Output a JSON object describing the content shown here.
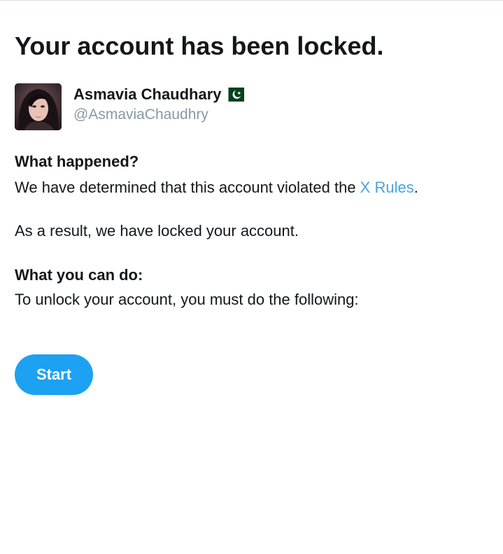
{
  "page": {
    "title": "Your account has been locked."
  },
  "profile": {
    "name": "Asmavia Chaudhary",
    "flag_icon": "pakistan-flag-icon",
    "handle": "@AsmaviaChaudhry",
    "avatar": "profile-photo"
  },
  "what_happened": {
    "heading": "What happened?",
    "text_before_link": "We have determined that this account violated the ",
    "link_label": "X Rules",
    "text_after_link": ".",
    "result_text": "As a result, we have locked your account."
  },
  "what_you_can_do": {
    "heading": "What you can do:",
    "text": "To unlock your account, you must do the following:"
  },
  "actions": {
    "start_label": "Start"
  },
  "colors": {
    "primary_text": "#14171a",
    "secondary_text": "#8899a6",
    "link": "#4aa3df",
    "button_background": "#1da1f2",
    "button_text": "#ffffff"
  }
}
